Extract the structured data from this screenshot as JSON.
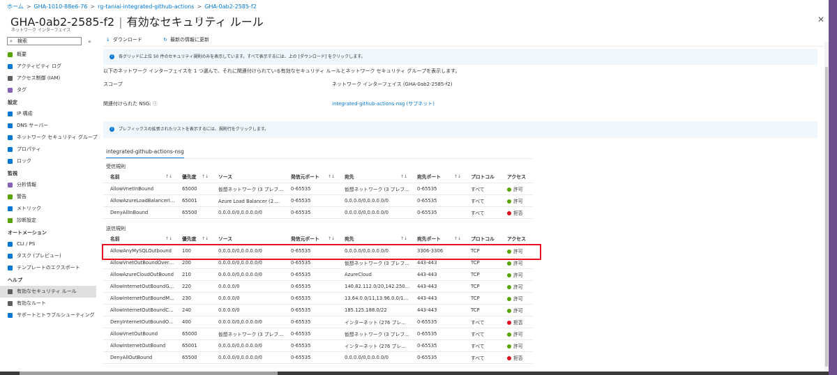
{
  "breadcrumb": [
    "ホーム",
    "GHA-1010-88e6-76",
    "rg-taniai-integrated-github-actions",
    "GHA-0ab2-2585-f2"
  ],
  "header": {
    "title": "GHA-0ab2-2585-f2",
    "separator": "|",
    "page": "有効なセキュリティ ルール",
    "subtitle": "ネットワーク インターフェイス",
    "star": "☆",
    "more": "···",
    "close": "✕"
  },
  "sidebar": {
    "search_placeholder": "検索",
    "collapse": "«",
    "items": [
      {
        "type": "item",
        "label": "概要",
        "color": "#57a300"
      },
      {
        "type": "item",
        "label": "アクティビティ ログ",
        "color": "#0078d4"
      },
      {
        "type": "item",
        "label": "アクセス制御 (IAM)",
        "color": "#605e5c"
      },
      {
        "type": "item",
        "label": "タグ",
        "color": "#8764b8"
      },
      {
        "type": "section",
        "label": "設定"
      },
      {
        "type": "item",
        "label": "IP 構成",
        "color": "#0078d4"
      },
      {
        "type": "item",
        "label": "DNS サーバー",
        "color": "#0078d4"
      },
      {
        "type": "item",
        "label": "ネットワーク セキュリティ グループ",
        "color": "#0078d4"
      },
      {
        "type": "item",
        "label": "プロパティ",
        "color": "#0078d4"
      },
      {
        "type": "item",
        "label": "ロック",
        "color": "#0078d4"
      },
      {
        "type": "section",
        "label": "監視"
      },
      {
        "type": "item",
        "label": "分析情報",
        "color": "#8764b8"
      },
      {
        "type": "item",
        "label": "警告",
        "color": "#57a300"
      },
      {
        "type": "item",
        "label": "メトリック",
        "color": "#0078d4"
      },
      {
        "type": "item",
        "label": "診断設定",
        "color": "#57a300"
      },
      {
        "type": "section",
        "label": "オートメーション"
      },
      {
        "type": "item",
        "label": "CLI / PS",
        "color": "#0078d4"
      },
      {
        "type": "item",
        "label": "タスク (プレビュー)",
        "color": "#0078d4"
      },
      {
        "type": "item",
        "label": "テンプレートのエクスポート",
        "color": "#0078d4"
      },
      {
        "type": "section",
        "label": "ヘルプ"
      },
      {
        "type": "item",
        "label": "有効なセキュリティ ルール",
        "color": "#605e5c",
        "active": true
      },
      {
        "type": "item",
        "label": "有効なルート",
        "color": "#605e5c"
      },
      {
        "type": "item",
        "label": "サポートとトラブルシューティング",
        "color": "#0078d4"
      }
    ]
  },
  "toolbar": {
    "download": "ダウンロード",
    "refresh": "最新の情報に更新",
    "download_icon": "↓",
    "refresh_icon": "↻"
  },
  "info1": "各グリッドに上位 50 件のセキュリティ規則のみを表示しています。すべて表示するには、上の [ダウンロード] をクリックします。",
  "description": "以下のネットワーク インターフェイスを 1 つ選んで、それに関連付けられている有効なセキュリティ ルールとネットワーク セキュリティ グループを表示します。",
  "scope": {
    "label": "スコープ",
    "value": "ネットワーク インターフェイス (GHA-0ab2-2585-f2)"
  },
  "nsg": {
    "label": "関連付けられた NSG:",
    "info": "ⓘ",
    "value": "integrated-github-actions-nsg (サブネット)"
  },
  "info2": "プレフィックスの拡張されたリストを表示するには、規則行をクリックします。",
  "tab": "integrated-github-actions-nsg",
  "columns": [
    "名前",
    "優先度",
    "ソース",
    "発信元ポート",
    "宛先",
    "宛先ポート",
    "プロトコル",
    "アクセス"
  ],
  "sort_icon": "↑↓",
  "inbound": {
    "title": "受信規則",
    "rows": [
      [
        "AllowVnetInBound",
        "65000",
        "仮想ネットワーク (3 プレフィックス)",
        "0-65535",
        "仮想ネットワーク (3 プレフィックス)",
        "0-65535",
        "すべて",
        "許可"
      ],
      [
        "AllowAzureLoadBalancerIn...",
        "65001",
        "Azure Load Balancer (2 プレ...",
        "0-65535",
        "0.0.0.0/0,0.0.0.0/0",
        "0-65535",
        "すべて",
        "許可"
      ],
      [
        "DenyAllInBound",
        "65500",
        "0.0.0.0/0,0.0.0.0/0",
        "0-65535",
        "0.0.0.0/0,0.0.0.0/0",
        "0-65535",
        "すべて",
        "拒否"
      ]
    ]
  },
  "outbound": {
    "title": "送信規則",
    "rows": [
      [
        "AllowAnyMySQLOutbound",
        "100",
        "0.0.0.0/0,0.0.0.0/0",
        "0-65535",
        "0.0.0.0/0,0.0.0.0/0",
        "3306-3306",
        "TCP",
        "許可"
      ],
      [
        "AllowVnetOutBoundOverwrite",
        "200",
        "0.0.0.0/0,0.0.0.0/0",
        "0-65535",
        "仮想ネットワーク (3 プレフィックス)",
        "443-443",
        "TCP",
        "許可"
      ],
      [
        "AllowAzureCloudOutBound",
        "210",
        "0.0.0.0/0,0.0.0.0/0",
        "0-65535",
        "AzureCloud",
        "443-443",
        "TCP",
        "許可"
      ],
      [
        "AllowInternetOutBoundGitH...",
        "220",
        "0.0.0.0/0",
        "0-65535",
        "140.82.112.0/20,142.250....",
        "443-443",
        "TCP",
        "許可"
      ],
      [
        "AllowInternetOutBoundMicr...",
        "230",
        "0.0.0.0/0",
        "0-65535",
        "13.64.0.0/11,13.96.0.0/13...",
        "443-443",
        "TCP",
        "許可"
      ],
      [
        "AllowInternetOutBoundCan...",
        "240",
        "0.0.0.0/0",
        "0-65535",
        "185.125.188.0/22",
        "443-443",
        "TCP",
        "許可"
      ],
      [
        "DenyInternetOutBoundOve...",
        "400",
        "0.0.0.0/0,0.0.0.0/0",
        "0-65535",
        "インターネット (276 プレフィックス)",
        "0-65535",
        "すべて",
        "拒否"
      ],
      [
        "AllowVnetOutBound",
        "65000",
        "仮想ネットワーク (3 プレフィックス)",
        "0-65535",
        "仮想ネットワーク (3 プレフィックス)",
        "0-65535",
        "すべて",
        "許可"
      ],
      [
        "AllowInternetOutBound",
        "65001",
        "0.0.0.0/0,0.0.0.0/0",
        "0-65535",
        "インターネット (276 プレフィックス)",
        "0-65535",
        "すべて",
        "許可"
      ],
      [
        "DenyAllOutBound",
        "65500",
        "0.0.0.0/0,0.0.0.0/0",
        "0-65535",
        "0.0.0.0/0,0.0.0.0/0",
        "0-65535",
        "すべて",
        "拒否"
      ]
    ]
  },
  "colors": {
    "allow": "#57a300",
    "deny": "#e00b1c",
    "highlight": "#e81123",
    "link": "#0078d4"
  }
}
